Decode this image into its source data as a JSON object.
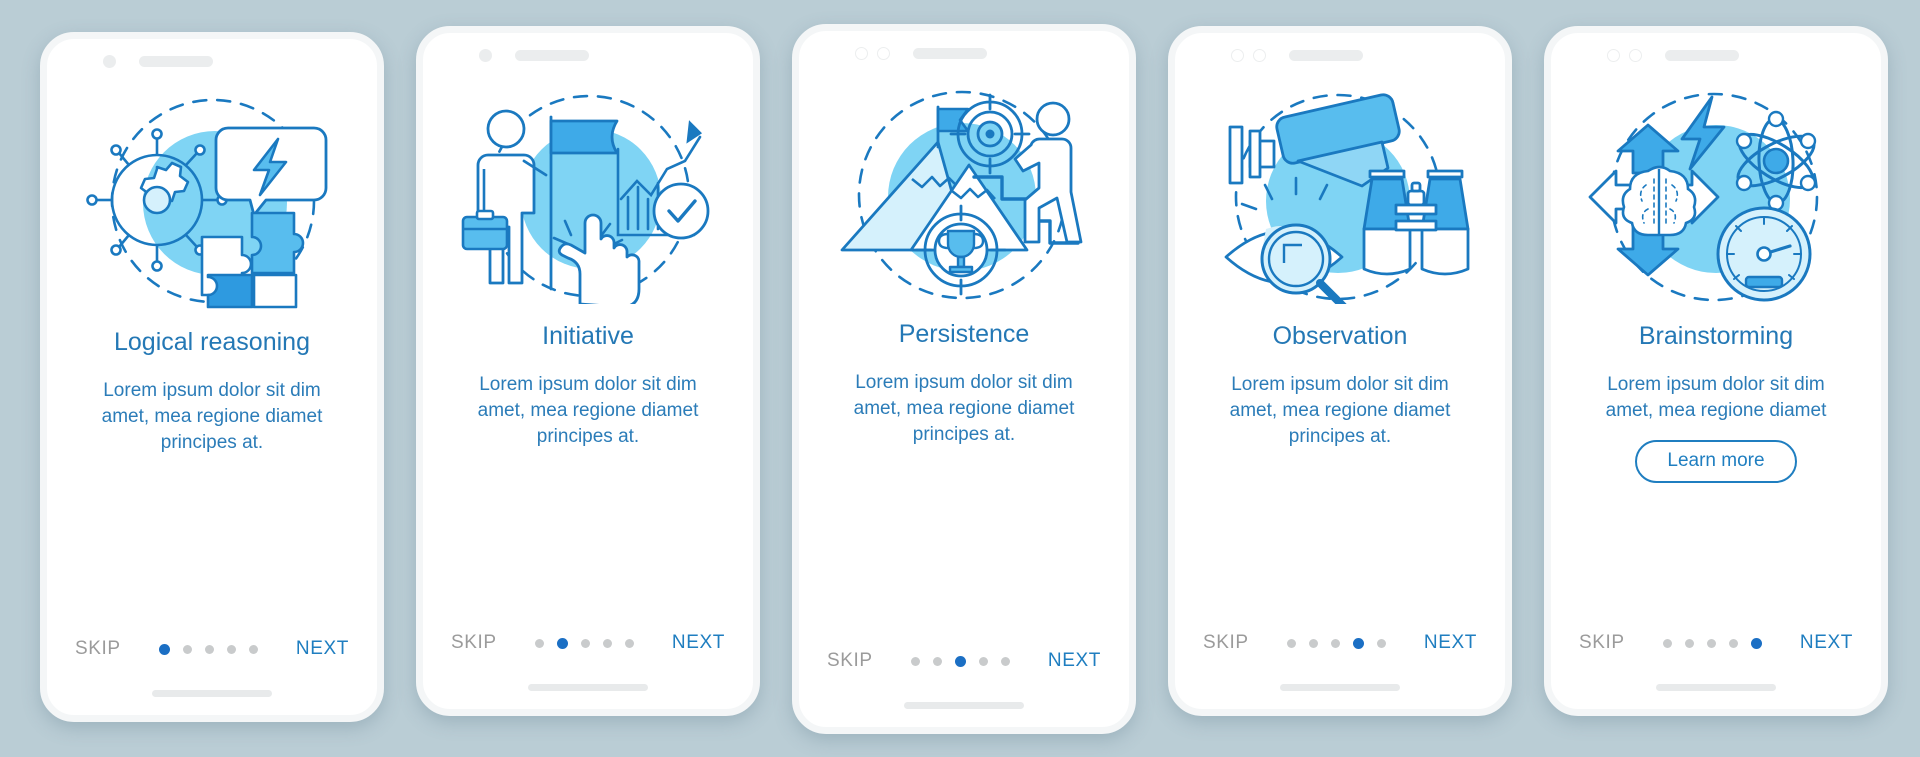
{
  "background_color": "#bacdd5",
  "theme": {
    "title_color": "#2478b5",
    "body_color": "#2b7cb8",
    "accent_color": "#1f7ec0",
    "skip_color": "#9b9b9b",
    "dot_active_color": "#1b6fc4",
    "dot_inactive_color": "#c9cbcc",
    "blob_color": "#7fd4f4",
    "stroke_color": "#1a79c0",
    "fill_light": "#d5f1fc",
    "fill_mid": "#58bdee"
  },
  "screens": [
    {
      "id": "logical-reasoning",
      "title": "Logical reasoning",
      "body": "Lorem ipsum dolor sit dim amet, mea regione diamet principes at.",
      "illustration": "gear-network-lightning-puzzle",
      "status_dots": 1,
      "skip_label": "SKIP",
      "next_label": "NEXT",
      "dots_total": 5,
      "active_dot": 1,
      "learn_more": null
    },
    {
      "id": "initiative",
      "title": "Initiative",
      "body": "Lorem ipsum dolor sit dim amet, mea regione diamet principes at.",
      "illustration": "person-flag-chart-check-cursor",
      "status_dots": 1,
      "skip_label": "SKIP",
      "next_label": "NEXT",
      "dots_total": 5,
      "active_dot": 2,
      "learn_more": null
    },
    {
      "id": "persistence",
      "title": "Persistence",
      "body": "Lorem ipsum dolor sit dim amet, mea regione diamet principes at.",
      "illustration": "mountain-flag-target-stairs-trophy",
      "status_dots": 2,
      "skip_label": "SKIP",
      "next_label": "NEXT",
      "dots_total": 5,
      "active_dot": 3,
      "learn_more": null
    },
    {
      "id": "observation",
      "title": "Observation",
      "body": "Lorem ipsum dolor sit dim amet, mea regione diamet principes at.",
      "illustration": "cctv-eye-magnifier-binoculars",
      "status_dots": 2,
      "skip_label": "SKIP",
      "next_label": "NEXT",
      "dots_total": 5,
      "active_dot": 4,
      "learn_more": null
    },
    {
      "id": "brainstorming",
      "title": "Brainstorming",
      "body": "Lorem ipsum dolor sit dim amet, mea regione diamet",
      "illustration": "brain-arrows-lightning-atom-gauge",
      "status_dots": 2,
      "skip_label": "SKIP",
      "next_label": "NEXT",
      "dots_total": 5,
      "active_dot": 5,
      "learn_more": "Learn more"
    }
  ]
}
